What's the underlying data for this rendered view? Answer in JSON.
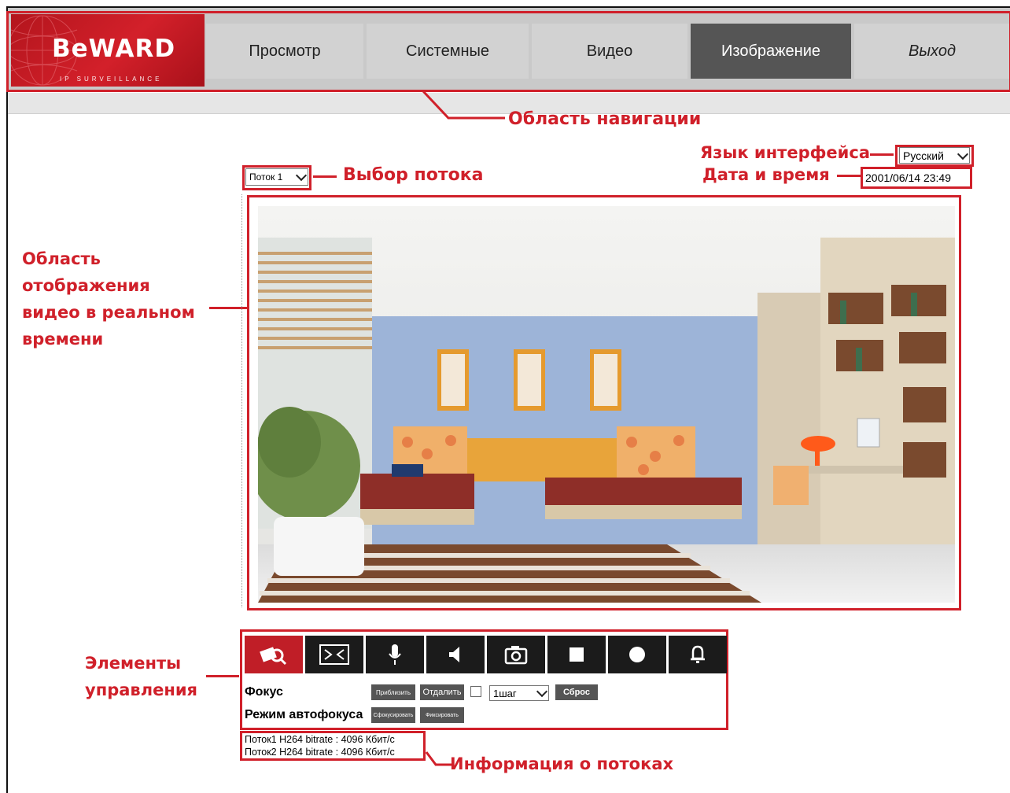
{
  "logo": {
    "brand": "BeWARD",
    "tagline": "IP SURVEILLANCE"
  },
  "nav": {
    "tabs": [
      {
        "label": "Просмотр"
      },
      {
        "label": "Системные"
      },
      {
        "label": "Видео"
      },
      {
        "label": "Изображение"
      },
      {
        "label": "Выход"
      }
    ],
    "active_tab": "Изображение"
  },
  "header": {
    "language": "Русский",
    "datetime": "2001/06/14 23:49",
    "stream_select": "Поток 1"
  },
  "annotations": {
    "nav_area": "Область навигации",
    "language": "Язык интерфейса",
    "datetime": "Дата и время",
    "stream_select": "Выбор потока",
    "video_area": [
      "Область",
      "отображения",
      "видео в реальном",
      "времени"
    ],
    "controls": [
      "Элементы",
      "управления"
    ],
    "stream_info": "Информация о потоках"
  },
  "controls": {
    "buttons": [
      {
        "icon": "zoom-view-icon",
        "active": true
      },
      {
        "icon": "fit-screen-icon"
      },
      {
        "icon": "microphone-icon"
      },
      {
        "icon": "speaker-icon"
      },
      {
        "icon": "snapshot-camera-icon"
      },
      {
        "icon": "stop-icon"
      },
      {
        "icon": "record-icon"
      },
      {
        "icon": "alarm-bell-icon"
      }
    ],
    "focus": {
      "label": "Фокус",
      "zoom_in": "Приблизить",
      "zoom_out": "Отдалить",
      "step": "1шаг",
      "reset": "Сброс"
    },
    "autofocus": {
      "label": "Режим автофокуса",
      "focus": "Сфокусировать",
      "fix": "Фиксировать"
    }
  },
  "stream_info": [
    "Поток1 H264 bitrate : 4096 Кбит/с",
    "Поток2 H264 bitrate : 4096 Кбит/с"
  ],
  "colors": {
    "brand": "#c01e27",
    "annotation": "#d0202a",
    "active_tab": "#555555"
  }
}
